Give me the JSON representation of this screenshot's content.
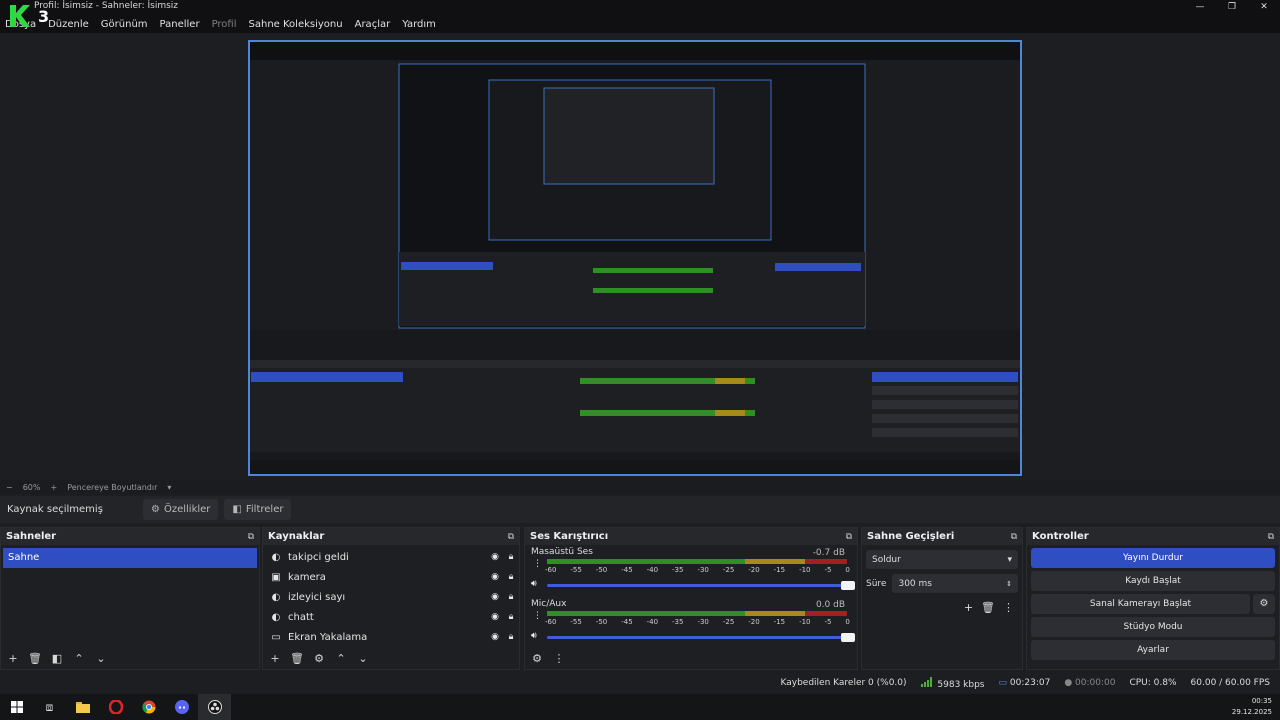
{
  "window": {
    "title": "Profil: İsimsiz - Sahneler: İsimsiz",
    "logo_text": "K3",
    "minimize": "—",
    "maximize": "❐",
    "close": "✕"
  },
  "menu": [
    "Dosya",
    "Düzenle",
    "Görünüm",
    "Paneller",
    "Profil",
    "Sahne Koleksiyonu",
    "Araçlar",
    "Yardım"
  ],
  "menu_disabled_index": 4,
  "zoom": {
    "minus": "−",
    "value": "60%",
    "plus": "+",
    "fit_label": "Pencereye Boyutlandır"
  },
  "source_toolbar": {
    "no_selection": "Kaynak seçilmemiş",
    "properties": "Özellikler",
    "filters": "Filtreler"
  },
  "scenes": {
    "title": "Sahneler",
    "items": [
      "Sahne"
    ]
  },
  "sources": {
    "title": "Kaynaklar",
    "items": [
      {
        "name": "takipci geldi",
        "icon": "browser-icon"
      },
      {
        "name": "kamera",
        "icon": "camera-icon"
      },
      {
        "name": "izleyici sayı",
        "icon": "browser-icon"
      },
      {
        "name": "chatt",
        "icon": "browser-icon"
      },
      {
        "name": "Ekran Yakalama",
        "icon": "monitor-icon"
      }
    ]
  },
  "mixer": {
    "title": "Ses Karıştırıcı",
    "scale": [
      "-60",
      "-55",
      "-50",
      "-45",
      "-40",
      "-35",
      "-30",
      "-25",
      "-20",
      "-15",
      "-10",
      "-5",
      "0"
    ],
    "channels": [
      {
        "name": "Masaüstü Ses",
        "db": "-0.7 dB",
        "volume": 1.0
      },
      {
        "name": "Mic/Aux",
        "db": "0.0 dB",
        "volume": 1.0
      }
    ]
  },
  "transitions": {
    "title": "Sahne Geçişleri",
    "selected": "Soldur",
    "duration_label": "Süre",
    "duration_value": "300 ms"
  },
  "controls": {
    "title": "Kontroller",
    "stop_stream": "Yayını Durdur",
    "start_recording": "Kaydı Başlat",
    "virtual_cam": "Sanal Kamerayı Başlat",
    "studio_mode": "Stüdyo Modu",
    "settings": "Ayarlar"
  },
  "status": {
    "dropped_frames": "Kaybedilen Kareler 0 (%0.0)",
    "bitrate": "5983 kbps",
    "stream_time": "00:23:07",
    "record_time": "00:00:00",
    "cpu": "CPU: 0.8%",
    "fps": "60.00 / 60.00 FPS"
  },
  "taskbar": {
    "time": "00:35",
    "date": "29.12.2025",
    "icons": [
      "windows-start-icon",
      "task-view-icon",
      "file-explorer-icon",
      "opera-icon",
      "chrome-icon",
      "discord-icon",
      "obs-icon"
    ]
  },
  "colors": {
    "accent": "#2f4ec2",
    "preview_border": "#4f86d6",
    "meter_green": "#2f8f24",
    "meter_yellow": "#a88a1c",
    "meter_red": "#a32020"
  }
}
